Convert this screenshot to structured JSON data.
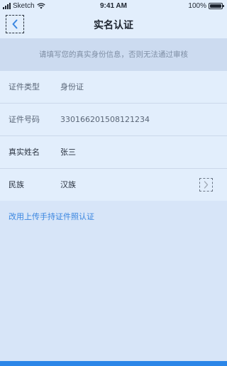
{
  "status_bar": {
    "carrier": "Sketch",
    "time": "9:41 AM",
    "battery": "100%",
    "battery_level": 1.0
  },
  "nav": {
    "title": "实名认证",
    "back_icon": "chevron-left-icon"
  },
  "notice": {
    "text": "请填写您的真实身份信息，否则无法通过审核"
  },
  "form": {
    "rows": [
      {
        "label": "证件类型",
        "value": "身份证"
      },
      {
        "label": "证件号码",
        "value": "330166201508121234"
      },
      {
        "label": "真实姓名",
        "value": "张三"
      },
      {
        "label": "民族",
        "value": "汉族",
        "icon": "chevron-right-icon"
      }
    ]
  },
  "alt_link": {
    "text": "改用上传手持证件照认证"
  },
  "colors": {
    "accent": "#3a86e0",
    "bottom_bar": "#2c86e8",
    "background": "#d7e5f8",
    "surface": "#e2eefc"
  }
}
